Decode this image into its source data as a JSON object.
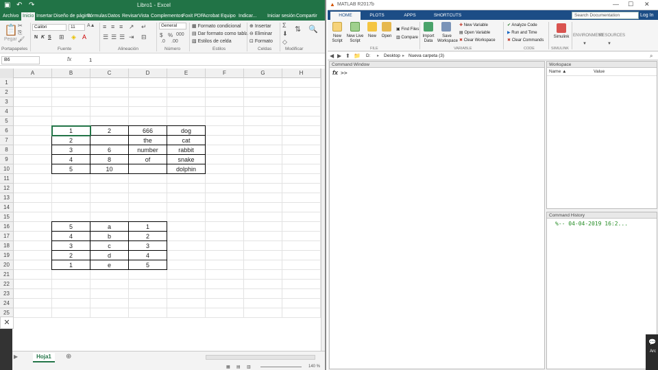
{
  "excel": {
    "title": "Libro1 - Excel",
    "tabs": [
      "Archivo",
      "Inicio",
      "Insertar",
      "Diseño de página",
      "Fórmulas",
      "Datos",
      "Revisar",
      "Vista",
      "Complementos",
      "Foxit PDF",
      "Acrobat",
      "Equipo",
      "Indicar...",
      "Iniciar sesión",
      "Compartir"
    ],
    "active_tab": "Inicio",
    "ribbon": {
      "paste": "Pegar",
      "font_name": "Calibri",
      "font_size": "11",
      "bold": "N",
      "italic": "K",
      "underline": "S",
      "number_format": "General",
      "conditional_format": "Formato condicional",
      "format_as_table": "Dar formato como tabla",
      "cell_styles": "Estilos de celda",
      "insert": "Insertar",
      "delete": "Eliminar",
      "format": "Formato",
      "groups": [
        "Portapapeles",
        "Fuente",
        "Alineación",
        "Número",
        "Estilos",
        "Celdas",
        "Modificar"
      ]
    },
    "name_box": "B6",
    "formula_value": "1",
    "columns": [
      "A",
      "B",
      "C",
      "D",
      "E",
      "F",
      "G",
      "H"
    ],
    "rows": [
      "1",
      "2",
      "3",
      "4",
      "5",
      "6",
      "7",
      "8",
      "9",
      "10",
      "11",
      "12",
      "13",
      "14",
      "15",
      "16",
      "17",
      "18",
      "19",
      "20",
      "21",
      "22",
      "23",
      "24",
      "25"
    ],
    "table1": [
      [
        "1",
        "2",
        "666",
        "dog"
      ],
      [
        "2",
        "",
        "the",
        "cat"
      ],
      [
        "3",
        "6",
        "number",
        "rabbit"
      ],
      [
        "4",
        "8",
        "of",
        "snake"
      ],
      [
        "5",
        "10",
        "",
        "dolphin"
      ]
    ],
    "table2": [
      [
        "5",
        "a",
        "1"
      ],
      [
        "4",
        "b",
        "2"
      ],
      [
        "3",
        "c",
        "3"
      ],
      [
        "2",
        "d",
        "4"
      ],
      [
        "1",
        "e",
        "5"
      ]
    ],
    "sheet_tab": "Hoja1",
    "zoom": "140 %",
    "accent": "#217346"
  },
  "matlab": {
    "title": "MATLAB R2017b",
    "tabs": [
      "HOME",
      "PLOTS",
      "APPS",
      "SHORTCUTS"
    ],
    "search_placeholder": "Search Documentation",
    "login": "Log In",
    "ribbon": {
      "new_script": "New Script",
      "new_live_script": "New Live Script",
      "new": "New",
      "open": "Open",
      "find_files": "Find Files",
      "compare": "Compare",
      "import_data": "Import Data",
      "save_workspace": "Save Workspace",
      "new_variable": "New Variable",
      "open_variable": "Open Variable",
      "clear_workspace": "Clear Workspace",
      "analyze_code": "Analyze Code",
      "run_and_time": "Run and Time",
      "clear_commands": "Clear Commands",
      "simulink": "Simulink",
      "environment": "ENVIRONMENT",
      "resources": "RESOURCES",
      "groups": [
        "FILE",
        "VARIABLE",
        "CODE",
        "SIMULINK"
      ]
    },
    "path": [
      "D:",
      "Desktop",
      "Nueva carpeta (3)"
    ],
    "command_window": {
      "header": "Command Window",
      "fx": "fx",
      "prompt": ">>"
    },
    "workspace": {
      "header": "Workspace",
      "col_name": "Name ▲",
      "col_value": "Value"
    },
    "history": {
      "header": "Command History",
      "entry": "%-- 04-04-2019 16:2..."
    },
    "accent": "#1c4d86"
  },
  "taskbar": {
    "close_glyph": "✕",
    "right_text": "Arc"
  }
}
